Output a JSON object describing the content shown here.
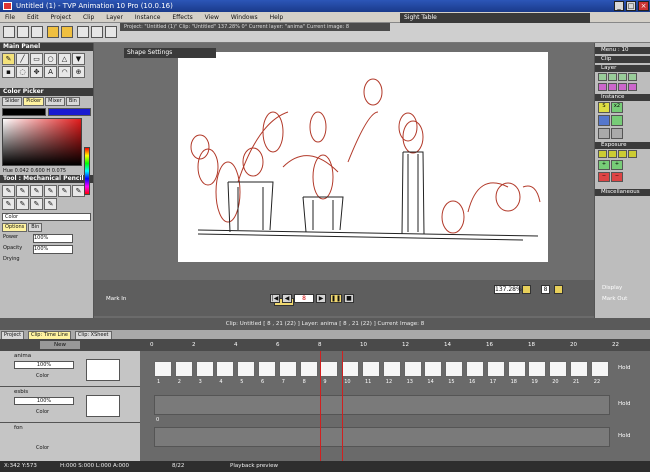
{
  "window": {
    "title": "Untitled (1) - TVP Animation 10 Pro (10.0.16)"
  },
  "menu": [
    "File",
    "Edit",
    "Project",
    "Clip",
    "Layer",
    "Instance",
    "Effects",
    "View",
    "Windows",
    "Help"
  ],
  "sketch_label": "Sight Table",
  "infobar": "Project: \"Untitled (1)\"  Clip: \"Untitled\"  137.28%  0°  Current layer: \"anima\"  Current image: 8",
  "left_panel": {
    "main_panel": "Main Panel",
    "color_picker": "Color Picker",
    "picker_tabs": [
      "Slider",
      "Picker",
      "Mixer",
      "Bin"
    ],
    "hsv": "Hue 0.042 0.600 H 0.075",
    "tool_title": "Tool : Mechanical Pencil",
    "color_label": "Color",
    "option_tabs": [
      "Options",
      "Bin"
    ],
    "power_label": "Power",
    "power_value": "100%",
    "opacity_label": "Opacity",
    "opacity_value": "100%",
    "drying_label": "Drying"
  },
  "shape_settings": "Shape Settings",
  "right_panel": {
    "top": "Menu : 10",
    "sections": [
      "Clip",
      "Layer",
      "Instance",
      "Exposure",
      "Miscellaneous"
    ]
  },
  "transport": {
    "mark_in": "Mark In",
    "mark_out": "Mark Out",
    "zoom": "137.28%",
    "display": "Display",
    "frame_value": "8",
    "left_value": "8"
  },
  "timeline": {
    "info": "Clip: Untitled [ 8 , 21 (22) ]    Layer: anima [ 8 , 21 (22) ]    Current Image: 8",
    "tabs": [
      "Project",
      "Clip: Time Line",
      "Clip: XSheet"
    ],
    "new_label": "New",
    "layers": [
      {
        "name": "anima",
        "opacity": "100%",
        "color": "Color"
      },
      {
        "name": "esbis",
        "opacity": "100%",
        "color": "Color"
      },
      {
        "name": "fon",
        "opacity": "",
        "color": "Color"
      }
    ],
    "ruler": [
      "0",
      "2",
      "4",
      "6",
      "8",
      "10",
      "12",
      "14",
      "16",
      "18",
      "20",
      "22"
    ],
    "frames_row1": [
      "1",
      "2",
      "3",
      "4",
      "5",
      "6",
      "7",
      "8",
      "9",
      "10",
      "11",
      "12",
      "13",
      "14",
      "15",
      "16",
      "17",
      "18",
      "19",
      "20",
      "21",
      "22"
    ],
    "hold": "Hold",
    "row3_start": "0"
  },
  "status": {
    "coords": "X:342  Y:573",
    "hsl": "H:000 S:000 L:000 A:000",
    "frame": "8/22",
    "preview": "Playback preview"
  },
  "colors": {
    "accent": "#f4e27a",
    "title_blue": "#1a3a8a",
    "sketch_red": "#b23a2a",
    "playhead": "#d02020"
  }
}
